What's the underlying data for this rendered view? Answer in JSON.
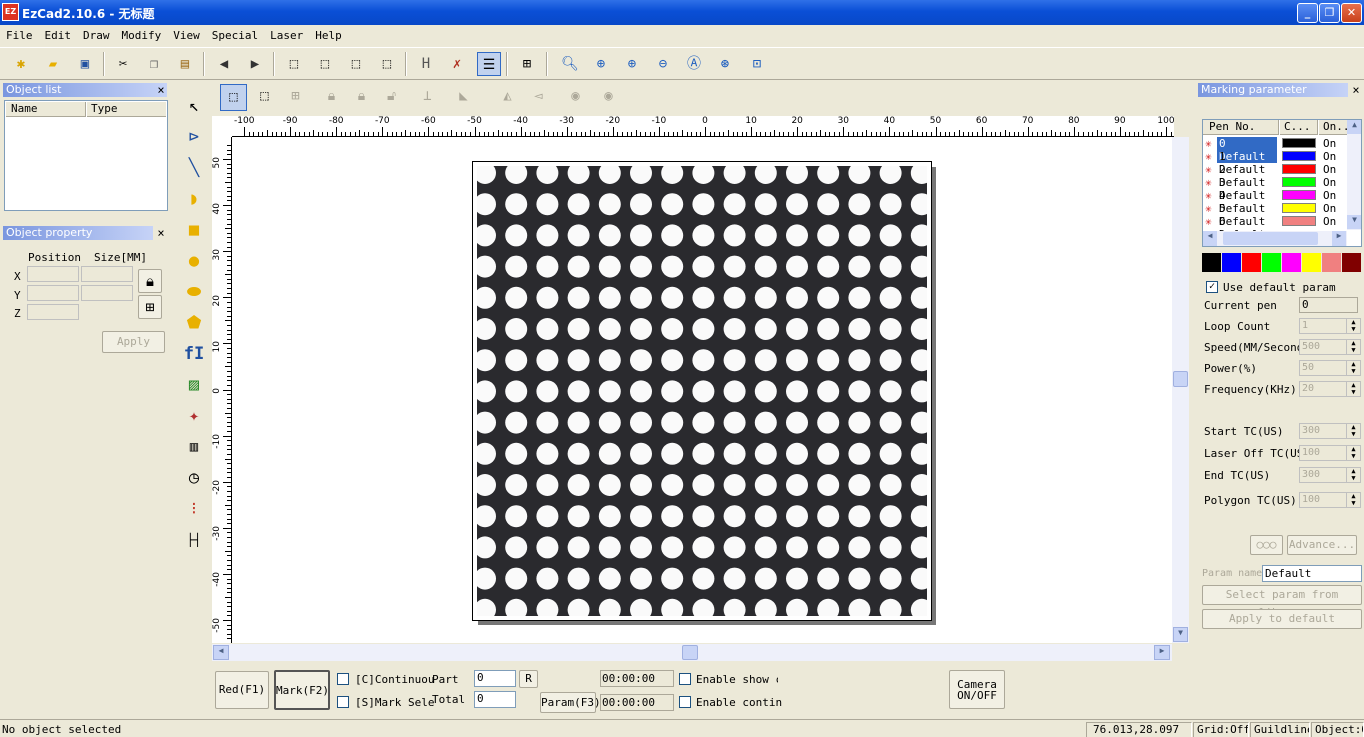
{
  "app": {
    "title": "EzCad2.10.6 - 无标题",
    "icon_label": "EZ"
  },
  "window_buttons": {
    "minimize": "_",
    "maximize": "❐",
    "close": "✕"
  },
  "menu": [
    "File",
    "Edit",
    "Draw",
    "Modify",
    "View",
    "Special",
    "Laser",
    "Help"
  ],
  "object_list": {
    "title": "Object list",
    "close": "×",
    "col_name": "Name",
    "col_type": "Type"
  },
  "object_property": {
    "title": "Object property",
    "close": "×",
    "position_label": "Position",
    "size_label": "Size[MM]",
    "x_label": "X",
    "y_label": "Y",
    "z_label": "Z",
    "apply_label": "Apply"
  },
  "ruler": {
    "h_ticks": [
      "-100",
      "-90",
      "-80",
      "-70",
      "-60",
      "-50",
      "-40",
      "-30",
      "-20",
      "-10",
      "0",
      "10",
      "20",
      "30",
      "40",
      "50",
      "60",
      "70",
      "80",
      "90",
      "100"
    ],
    "v_ticks": [
      "50",
      "40",
      "30",
      "20",
      "10",
      "0",
      "-10",
      "-20",
      "-30",
      "-40",
      "-50"
    ]
  },
  "bottom_bar": {
    "red_label": "Red(F1)",
    "mark_label": "Mark(F2)",
    "continuous_label": "[C]Continuou",
    "mark_select_label": "[S]Mark Sele",
    "part_label": "Part",
    "total_label": "Total",
    "part_value": "0",
    "total_value": "0",
    "r_label": "R",
    "param_label": "Param(F3)",
    "time1": "00:00:00",
    "time2": "00:00:00",
    "enable_show_label": "Enable show c",
    "enable_continue_label": "Enable continu",
    "camera_label_1": "Camera",
    "camera_label_2": "ON/OFF"
  },
  "marking": {
    "title": "Marking parameter",
    "close": "×",
    "col_pen": "Pen No.",
    "col_color": "C...",
    "col_on": "On...",
    "pens": [
      {
        "label": "0 Default",
        "color": "#000000",
        "on": "On"
      },
      {
        "label": "1 Default",
        "color": "#0000ff",
        "on": "On"
      },
      {
        "label": "2 Default",
        "color": "#ff0000",
        "on": "On"
      },
      {
        "label": "3 Default",
        "color": "#00ff00",
        "on": "On"
      },
      {
        "label": "4 Default",
        "color": "#ff00ff",
        "on": "On"
      },
      {
        "label": "5 Default",
        "color": "#ffff00",
        "on": "On"
      },
      {
        "label": "6 Default",
        "color": "#f08080",
        "on": "On"
      }
    ],
    "palette": [
      "#000000",
      "#0000ff",
      "#ff0000",
      "#00ff00",
      "#ff00ff",
      "#ffff00",
      "#f08080",
      "#800000"
    ],
    "use_default_label": "Use default param",
    "current_pen_label": "Current pen",
    "current_pen_value": "0",
    "loop_count_label": "Loop Count",
    "loop_count_value": "1",
    "speed_label": "Speed(MM/Second",
    "speed_value": "500",
    "power_label": "Power(%)",
    "power_value": "50",
    "frequency_label": "Frequency(KHz)",
    "frequency_value": "20",
    "start_tc_label": "Start TC(US)",
    "start_tc_value": "300",
    "laser_off_tc_label": "Laser Off TC(US",
    "laser_off_tc_value": "100",
    "end_tc_label": "End TC(US)",
    "end_tc_value": "300",
    "polygon_tc_label": "Polygon TC(US)",
    "polygon_tc_value": "100",
    "advance_label": "Advance...",
    "param_name_label": "Param name",
    "param_name_value": "Default",
    "select_library_label": "Select param from library",
    "apply_default_label": "Apply to default"
  },
  "status": {
    "message": "No object selected",
    "coords": "76.013,28.097",
    "grid": "Grid:Off",
    "guideline": "Guildline",
    "object": "Object:Of"
  }
}
